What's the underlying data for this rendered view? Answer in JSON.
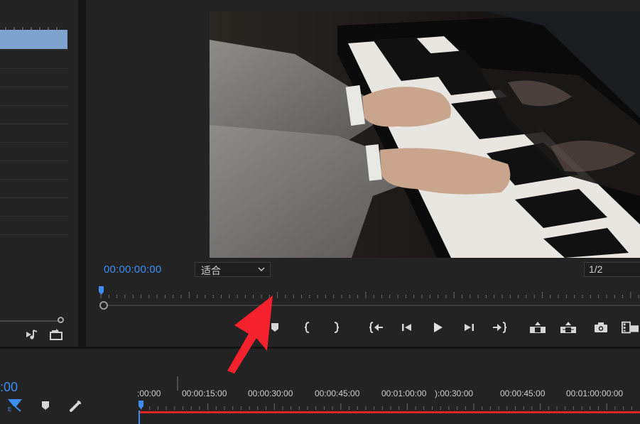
{
  "program_monitor": {
    "timecode": "00:00:00:00",
    "fit_select": {
      "value": "适合"
    },
    "resolution_select": {
      "value": "1/2"
    },
    "controls": [
      "add-marker-icon",
      "mark-in-icon",
      "mark-out-icon",
      "go-to-in-icon",
      "step-back-icon",
      "play-icon",
      "step-forward-icon",
      "go-to-out-icon",
      "lift-icon",
      "extract-icon",
      "export-frame-icon",
      "compare-view-icon"
    ],
    "video_description_icon": "piano-performance-frame"
  },
  "project_panel": {
    "footer_icons": [
      "automate-to-sequence-icon",
      "new-bin-icon"
    ]
  },
  "timeline": {
    "timecode": ":00",
    "ruler_labels": [
      ":00:00",
      "00:00:15:00",
      "00:00:30:00",
      "00:00:45:00",
      "00:01:00:00",
      "):00:30:00",
      "00:00:45:00",
      "00:01:00:00:00"
    ],
    "toolbar_icons": [
      "snap-icon",
      "add-marker-icon",
      "wrench-icon"
    ]
  },
  "colors": {
    "accent_blue": "#3d8ef0",
    "playhead_red": "#e02424",
    "annotation_arrow": "#f5222d"
  }
}
